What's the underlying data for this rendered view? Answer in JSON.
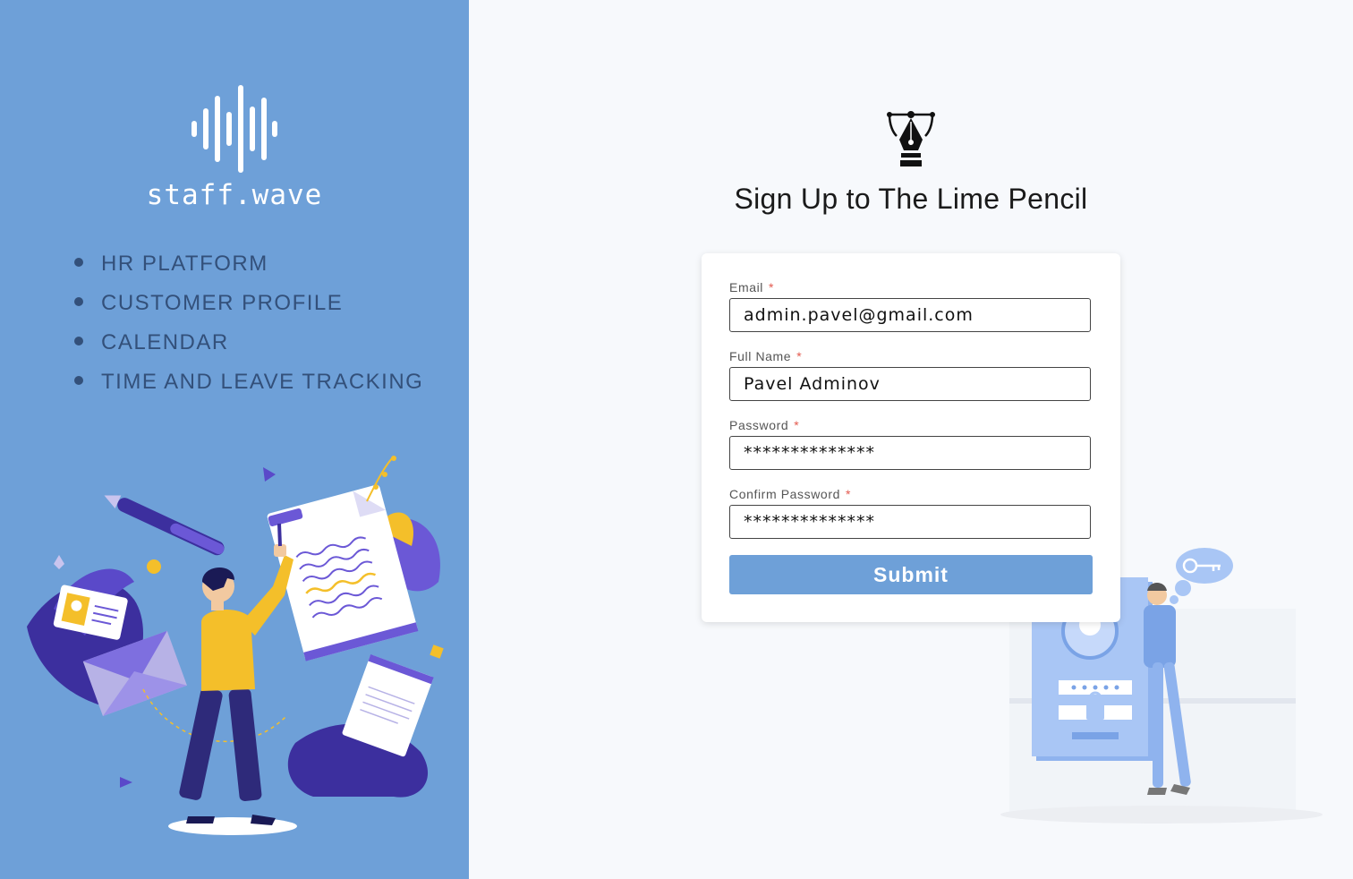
{
  "brand": {
    "name": "staff.wave",
    "logo_icon": "sound-wave-logo-icon",
    "panel_color": "#6ea0d8"
  },
  "features": [
    "HR PLATFORM",
    "CUSTOMER PROFILE",
    "CALENDAR",
    "TIME AND LEAVE TRACKING"
  ],
  "form": {
    "icon": "pen-tool-icon",
    "title": "Sign Up to The Lime Pencil",
    "required_marker": "*",
    "fields": {
      "email": {
        "label": "Email",
        "value": "admin.pavel@gmail.com"
      },
      "full_name": {
        "label": "Full Name",
        "value": "Pavel Adminov"
      },
      "password": {
        "label": "Password",
        "value": "**************"
      },
      "confirm_password": {
        "label": "Confirm Password",
        "value": "**************"
      }
    },
    "submit_label": "Submit",
    "accent_color": "#6ea0d8",
    "required_color": "#e35a4f"
  }
}
